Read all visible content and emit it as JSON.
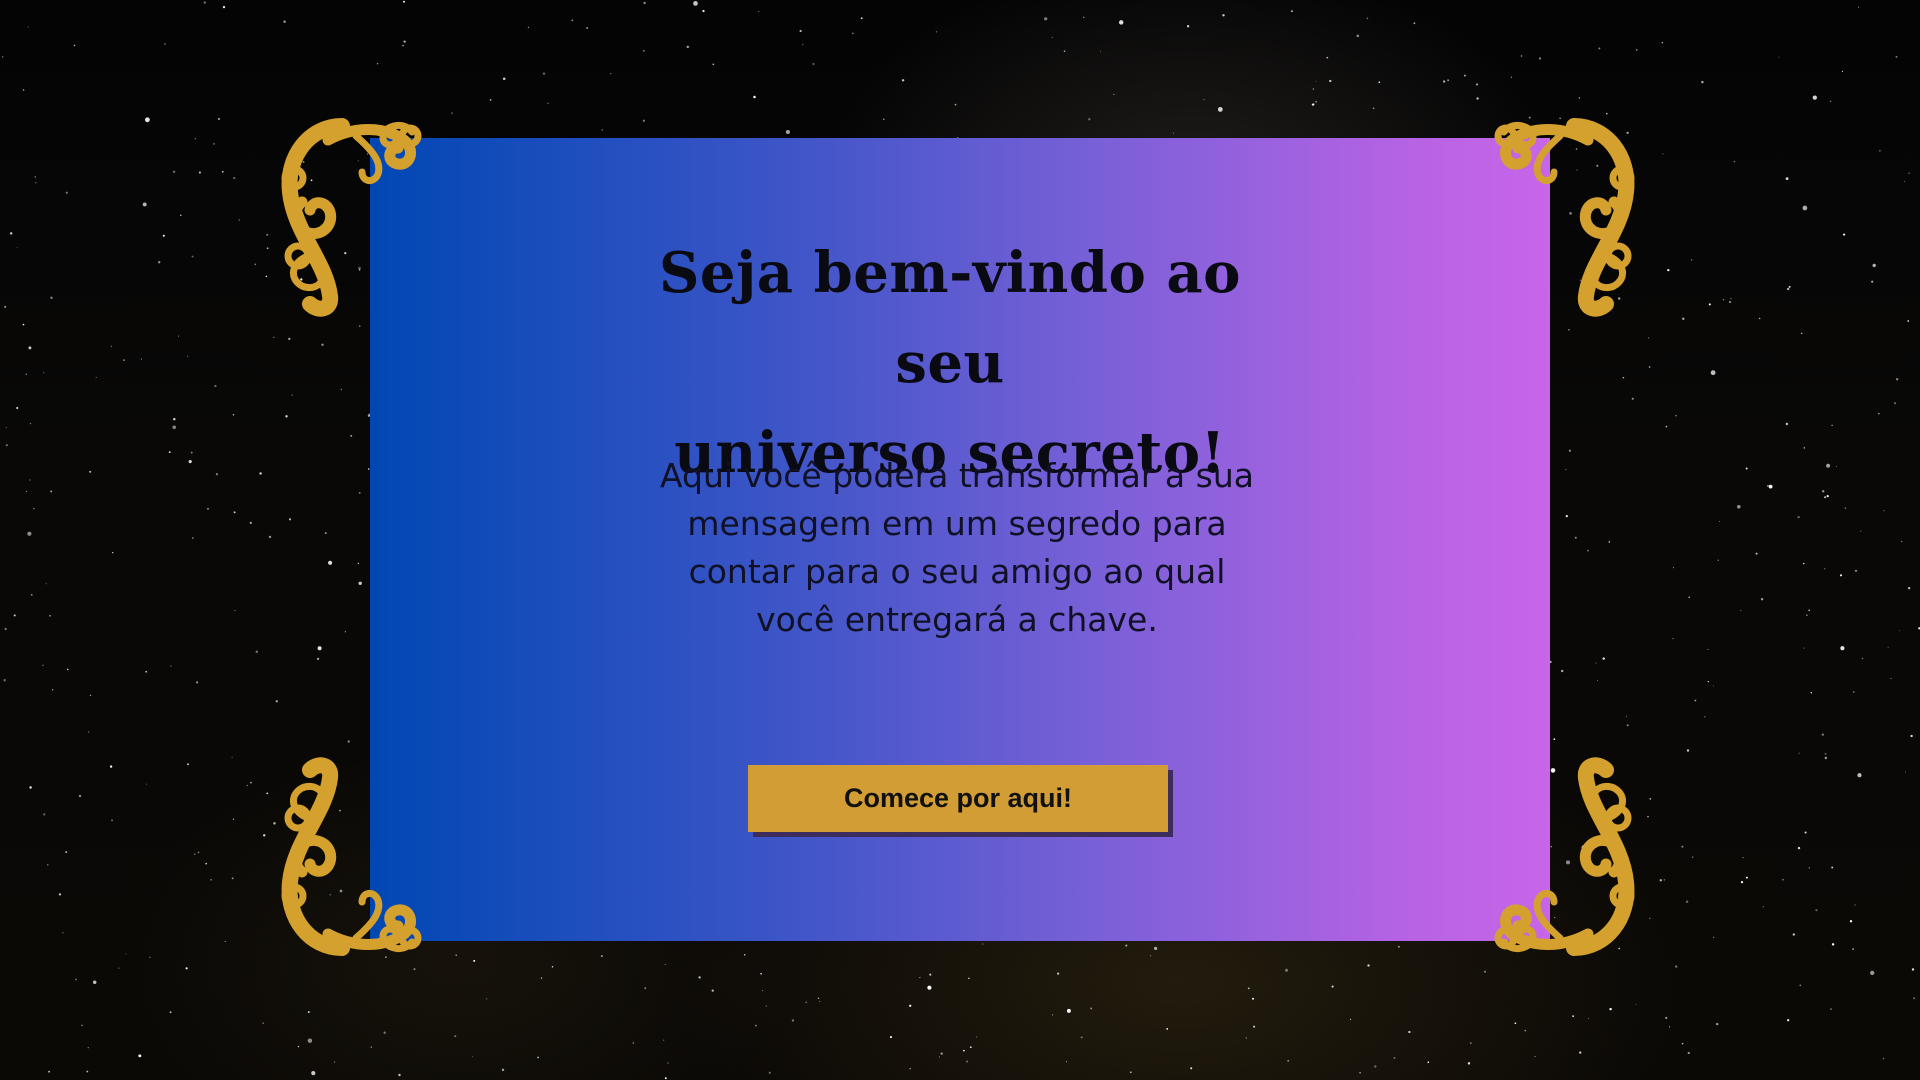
{
  "page": {
    "title_line_1": "Seja bem-vindo ao seu",
    "title_line_2": "universo secreto!",
    "body_line_1": "Aqui você poderá transformar a sua",
    "body_line_2": "mensagem em um segredo para",
    "body_line_3": "contar para o seu amigo ao qual",
    "body_line_4": "você entregará a chave.",
    "cta_label": "Comece por aqui!"
  },
  "theme": {
    "background": "#050507",
    "card_gradient_start": "#0047b4",
    "card_gradient_end": "#c865e8",
    "accent": "#d19d34",
    "text": "#0a0a12"
  },
  "decorations": {
    "top_left_icon": "scroll-ornament-icon",
    "top_right_icon": "scroll-ornament-icon",
    "bottom_left_icon": "scroll-ornament-icon",
    "bottom_right_icon": "scroll-ornament-icon"
  }
}
